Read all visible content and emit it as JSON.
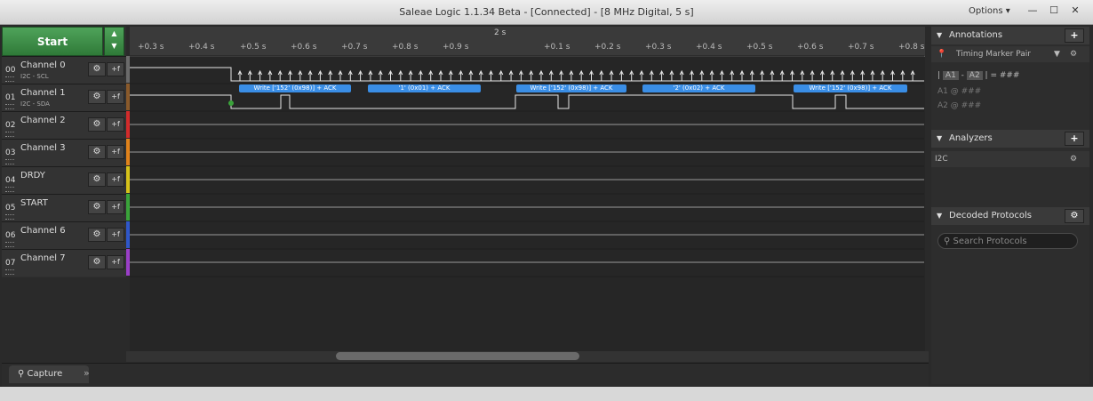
{
  "window": {
    "title": "Saleae Logic 1.1.34 Beta - [Connected] - [8 MHz Digital, 5 s]",
    "options_label": "Options ▾",
    "minimize": "—",
    "maximize": "☐",
    "close": "✕"
  },
  "toolbar": {
    "start_label": "Start",
    "arrows": "▲\n▼"
  },
  "timeline": {
    "center_label": "2 s",
    "ticks": [
      "+0.3 s",
      "+0.4 s",
      "+0.5 s",
      "+0.6 s",
      "+0.7 s",
      "+0.8 s",
      "+0.9 s",
      "+0.1 s",
      "+0.2 s",
      "+0.3 s",
      "+0.4 s",
      "+0.5 s",
      "+0.6 s",
      "+0.7 s",
      "+0.8 s"
    ]
  },
  "channels": [
    {
      "num": "00",
      "name": "Channel 0",
      "sub": "I2C - SCL",
      "color": "#6b6b6b"
    },
    {
      "num": "01",
      "name": "Channel 1",
      "sub": "I2C - SDA",
      "color": "#8a5a2b"
    },
    {
      "num": "02",
      "name": "Channel 2",
      "sub": "",
      "color": "#d22b2b"
    },
    {
      "num": "03",
      "name": "Channel 3",
      "sub": "",
      "color": "#e0821b"
    },
    {
      "num": "04",
      "name": "DRDY",
      "sub": "",
      "color": "#d6c21a"
    },
    {
      "num": "05",
      "name": "START",
      "sub": "",
      "color": "#3aa33a"
    },
    {
      "num": "06",
      "name": "Channel 6",
      "sub": "",
      "color": "#2f57c9"
    },
    {
      "num": "07",
      "name": "Channel 7",
      "sub": "",
      "color": "#9a3fc7"
    }
  ],
  "decodes": [
    "Write ['152' (0x98)] + ACK",
    "'1' (0x01) + ACK",
    "Write ['152' (0x98)] + ACK",
    "'2' (0x02) + ACK",
    "Write ['152' (0x98)] + ACK"
  ],
  "capture_tab": "Capture",
  "expand_icon": "»",
  "annotations": {
    "title": "Annotations",
    "add": "+",
    "timing_marker": "Timing Marker Pair",
    "pair_line_a": "A1",
    "pair_line_b": "A2",
    "pair_value": "= ###",
    "a1": "A1  @  ###",
    "a2": "A2  @  ###"
  },
  "analyzers": {
    "title": "Analyzers",
    "add": "+",
    "item": "I2C"
  },
  "decoded_protocols": {
    "title": "Decoded Protocols",
    "search_placeholder": "Search Protocols"
  }
}
